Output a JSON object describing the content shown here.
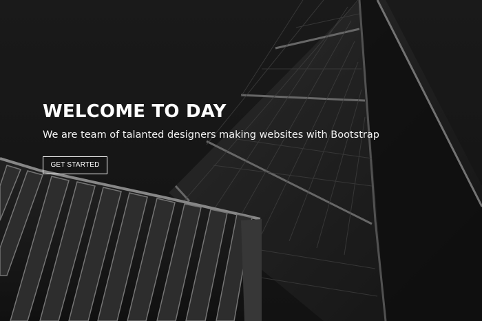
{
  "hero": {
    "title": "WELCOME TO DAY",
    "subtitle": "We are team of talanted designers making websites with Bootstrap",
    "cta_label": "GET STARTED"
  },
  "theme": {
    "background": "#1e1e1e",
    "text": "#ffffff"
  },
  "background_image": {
    "description_icon": "building-architecture-image"
  }
}
